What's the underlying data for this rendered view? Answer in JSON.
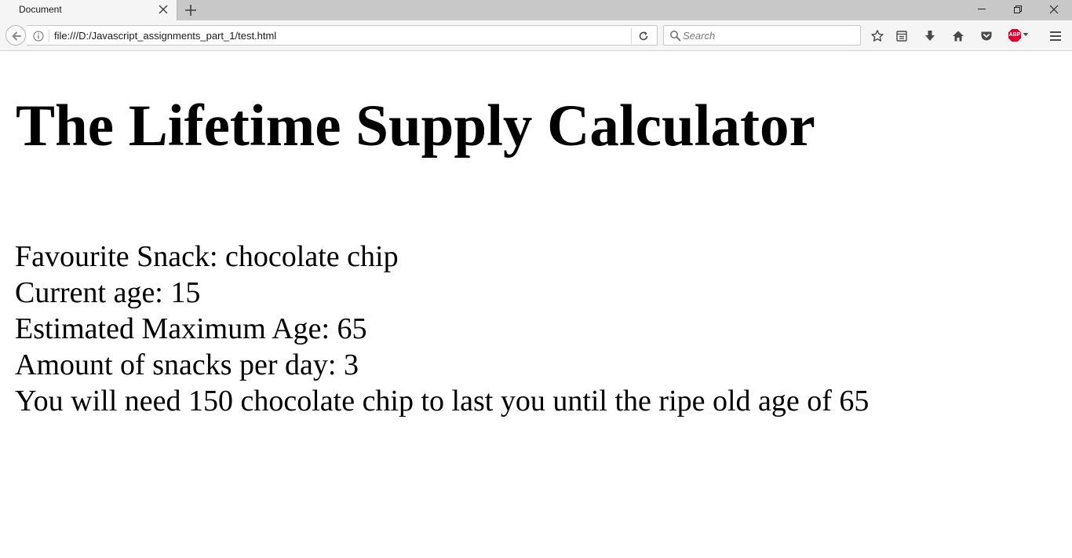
{
  "browser": {
    "tab": {
      "title": "Document"
    },
    "url": "file:///D:/Javascript_assignments_part_1/test.html",
    "search": {
      "placeholder": "Search"
    },
    "addon": {
      "label": "ABP"
    }
  },
  "page": {
    "title": "The Lifetime Supply Calculator",
    "lines": [
      "Favourite Snack: chocolate chip",
      "Current age: 15",
      "Estimated Maximum Age: 65",
      "Amount of snacks per day: 3",
      "You will need 150 chocolate chip to last you until the ripe old age of 65"
    ]
  },
  "colors": {
    "tabstrip": "#c8c8c8",
    "toolbar": "#f5f5f5",
    "abp_red": "#d8002b",
    "icon_gray": "#4a4a4a"
  },
  "icons": [
    "close-icon",
    "plus-icon",
    "minimize-icon",
    "restore-icon",
    "window-close-icon",
    "back-arrow-icon",
    "info-icon",
    "reload-icon",
    "search-icon",
    "star-icon",
    "reading-list-icon",
    "download-icon",
    "home-icon",
    "pocket-icon",
    "adblock-icon",
    "dropdown-arrow-icon",
    "hamburger-menu-icon"
  ]
}
